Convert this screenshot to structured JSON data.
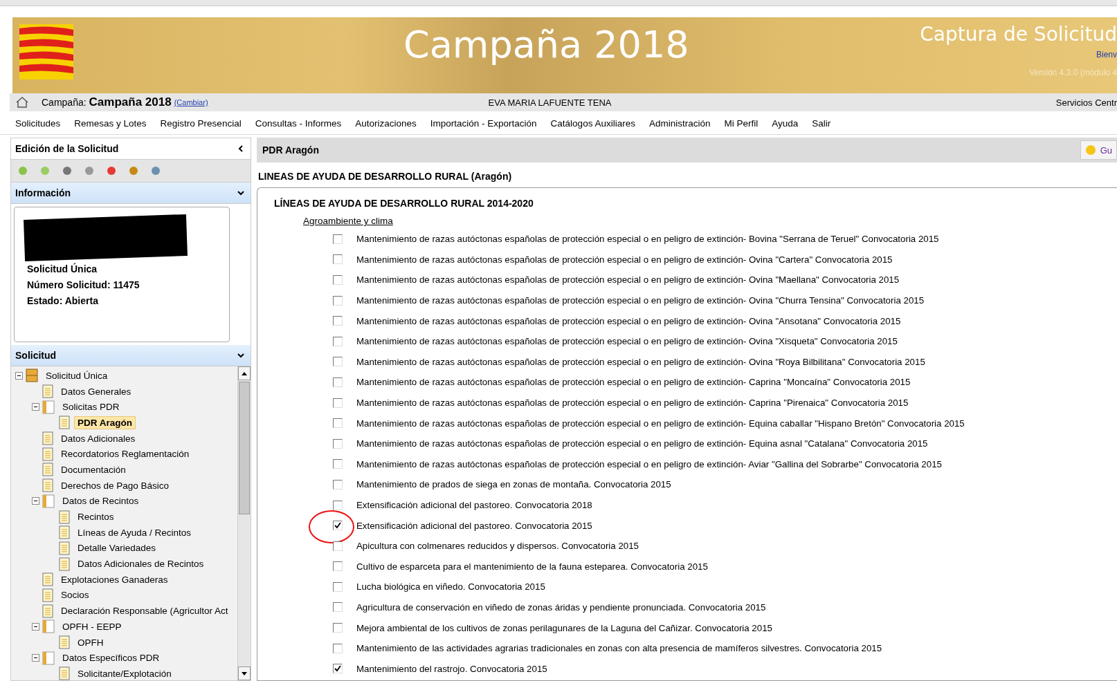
{
  "header": {
    "title": "Campaña 2018",
    "app_title": "Captura de Solicitud",
    "welcome": "Bienv",
    "version": "Versión 4.3.0 (módulo 4"
  },
  "info_bar": {
    "campaign_label": "Campaña:",
    "campaign": "Campaña 2018",
    "change_link": "(Cambiar)",
    "user": "EVA MARIA LAFUENTE TENA",
    "service": "Servicios Centr"
  },
  "menu": [
    "Solicitudes",
    "Remesas y Lotes",
    "Registro Presencial",
    "Consultas - Informes",
    "Autorizaciones",
    "Importación - Exportación",
    "Catálogos Auxiliares",
    "Administración",
    "Mi Perfil",
    "Ayuda",
    "Salir"
  ],
  "sidebar": {
    "edit_title": "Edición de la Solicitud",
    "info_title": "Información",
    "info_lines": [
      "Solicitud Única",
      "Número Solicitud: 11475",
      "Estado: Abierta"
    ],
    "tree_title": "Solicitud",
    "tree": [
      {
        "label": "Solicitud Única",
        "kind": "cabinet",
        "expanded": true,
        "selected": false,
        "children": [
          {
            "label": "Datos Generales",
            "kind": "document",
            "selected": false
          },
          {
            "label": "Solicitas PDR",
            "kind": "folder",
            "expanded": true,
            "selected": false,
            "children": [
              {
                "label": "PDR Aragón",
                "kind": "document",
                "selected": true
              }
            ]
          },
          {
            "label": "Datos Adicionales",
            "kind": "document",
            "selected": false
          },
          {
            "label": "Recordatorios Reglamentación",
            "kind": "document",
            "selected": false
          },
          {
            "label": "Documentación",
            "kind": "document",
            "selected": false
          },
          {
            "label": "Derechos de Pago Básico",
            "kind": "document",
            "selected": false
          },
          {
            "label": "Datos de Recintos",
            "kind": "folder",
            "expanded": true,
            "selected": false,
            "children": [
              {
                "label": "Recintos",
                "kind": "document",
                "selected": false
              },
              {
                "label": "Líneas de Ayuda / Recintos",
                "kind": "document",
                "selected": false
              },
              {
                "label": "Detalle Variedades",
                "kind": "document",
                "selected": false
              },
              {
                "label": "Datos Adicionales de Recintos",
                "kind": "document",
                "selected": false
              }
            ]
          },
          {
            "label": "Explotaciones Ganaderas",
            "kind": "document",
            "selected": false
          },
          {
            "label": "Socios",
            "kind": "document",
            "selected": false
          },
          {
            "label": "Declaración Responsable (Agricultor Act",
            "kind": "document",
            "selected": false
          },
          {
            "label": "OPFH - EEPP",
            "kind": "folder",
            "expanded": true,
            "selected": false,
            "children": [
              {
                "label": "OPFH",
                "kind": "document",
                "selected": false
              }
            ]
          },
          {
            "label": "Datos Específicos PDR",
            "kind": "folder",
            "expanded": true,
            "selected": false,
            "children": [
              {
                "label": "Solicitante/Explotación",
                "kind": "document",
                "selected": false
              }
            ]
          }
        ]
      }
    ]
  },
  "main": {
    "tab_title": "PDR Aragón",
    "guide_button": "Gu",
    "section_title": "LINEAS DE AYUDA DE DESARROLLO RURAL (Aragón)",
    "group_title": "LÍNEAS DE AYUDA DE DESARROLLO RURAL 2014-2020",
    "category": "Agroambiente y clima",
    "lines": [
      {
        "label": "Mantenimiento de razas autóctonas españolas de protección especial o en peligro de extinción- Bovina \"Serrana de Teruel\" Convocatoria 2015",
        "checked": false,
        "circled": false
      },
      {
        "label": "Mantenimiento de razas autóctonas españolas de protección especial o en peligro de extinción- Ovina \"Cartera\" Convocatoria 2015",
        "checked": false,
        "circled": false
      },
      {
        "label": "Mantenimiento de razas autóctonas españolas de protección especial o en peligro de extinción- Ovina \"Maellana\" Convocatoria 2015",
        "checked": false,
        "circled": false
      },
      {
        "label": "Mantenimiento de razas autóctonas españolas de protección especial o en peligro de extinción- Ovina \"Churra Tensina\" Convocatoria 2015",
        "checked": false,
        "circled": false
      },
      {
        "label": "Mantenimiento de razas autóctonas españolas de protección especial o en peligro de extinción- Ovina \"Ansotana\" Convocatoria 2015",
        "checked": false,
        "circled": false
      },
      {
        "label": "Mantenimiento de razas autóctonas españolas de protección especial o en peligro de extinción- Ovina \"Xisqueta\" Convocatoria 2015",
        "checked": false,
        "circled": false
      },
      {
        "label": "Mantenimiento de razas autóctonas españolas de protección especial o en peligro de extinción- Ovina \"Roya Bilbilitana\" Convocatoria 2015",
        "checked": false,
        "circled": false
      },
      {
        "label": "Mantenimiento de razas autóctonas españolas de protección especial o en peligro de extinción- Caprina \"Moncaína\" Convocatoria 2015",
        "checked": false,
        "circled": false
      },
      {
        "label": "Mantenimiento de razas autóctonas españolas de protección especial o en peligro de extinción- Caprina \"Pirenaica\" Convocatoria 2015",
        "checked": false,
        "circled": false
      },
      {
        "label": "Mantenimiento de razas autóctonas españolas de protección especial o en peligro de extinción- Equina caballar \"Hispano Bretón\" Convocatoria 2015",
        "checked": false,
        "circled": false
      },
      {
        "label": "Mantenimiento de razas autóctonas españolas de protección especial o en peligro de extinción- Equina asnal \"Catalana\" Convocatoria 2015",
        "checked": false,
        "circled": false
      },
      {
        "label": "Mantenimiento de razas autóctonas españolas de protección especial o en peligro de extinción- Aviar \"Gallina del Sobrarbe\" Convocatoria 2015",
        "checked": false,
        "circled": false
      },
      {
        "label": "Mantenimiento de prados de siega en zonas de montaña. Convocatoria 2015",
        "checked": false,
        "circled": false
      },
      {
        "label": "Extensificación adicional del pastoreo. Convocatoria 2018",
        "checked": false,
        "circled": false
      },
      {
        "label": "Extensificación adicional del pastoreo. Convocatoria 2015",
        "checked": true,
        "circled": true
      },
      {
        "label": "Apicultura con colmenares reducidos y dispersos. Convocatoria 2015",
        "checked": false,
        "circled": false
      },
      {
        "label": "Cultivo de esparceta para el mantenimiento de la fauna esteparea. Convocatoria 2015",
        "checked": false,
        "circled": false
      },
      {
        "label": "Lucha biológica en viñedo. Convocatoria 2015",
        "checked": false,
        "circled": false
      },
      {
        "label": "Agricultura de conservación en viñedo de zonas áridas y pendiente pronunciada. Convocatoria 2015",
        "checked": false,
        "circled": false
      },
      {
        "label": "Mejora ambiental de los cultivos de zonas perilagunares de la Laguna del Cañizar. Convocatoria 2015",
        "checked": false,
        "circled": false
      },
      {
        "label": "Mantenimiento de las actividades agrarias tradicionales en zonas con alta presencia de mamíferos silvestres. Convocatoria 2015",
        "checked": false,
        "circled": false
      },
      {
        "label": "Mantenimiento del rastrojo. Convocatoria 2015",
        "checked": true,
        "circled": false
      }
    ]
  }
}
